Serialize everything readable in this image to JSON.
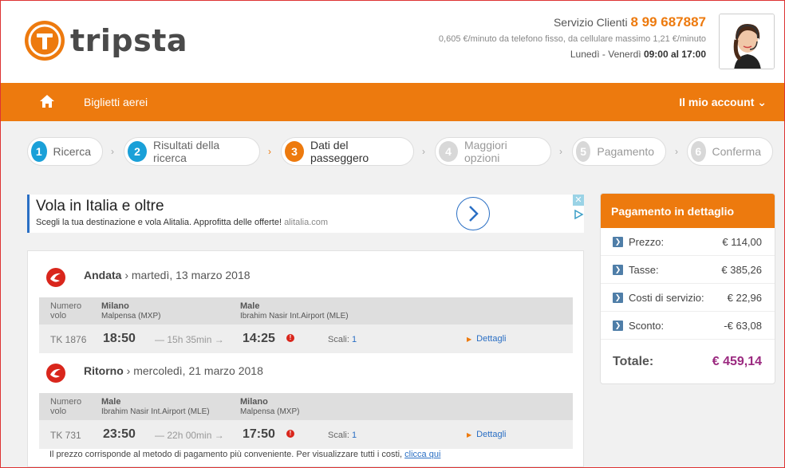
{
  "brand": {
    "name": "tripsta",
    "color": "#ed7a0e"
  },
  "contact": {
    "label": "Servizio Clienti",
    "phone": "8 99 687887",
    "rate": "0,605 €/minuto da telefono fisso, da cellulare massimo 1,21 €/minuto",
    "hours_prefix": "Lunedì - Venerdì",
    "hours": "09:00 al 17:00"
  },
  "nav": {
    "flights": "Biglietti aerei",
    "account": "Il mio account"
  },
  "steps": [
    {
      "n": "1",
      "label": "Ricerca",
      "state": "done"
    },
    {
      "n": "2",
      "label": "Risultati della ricerca",
      "state": "done"
    },
    {
      "n": "3",
      "label": "Dati del passeggero",
      "state": "active"
    },
    {
      "n": "4",
      "label": "Maggiori opzioni",
      "state": "future"
    },
    {
      "n": "5",
      "label": "Pagamento",
      "state": "future"
    },
    {
      "n": "6",
      "label": "Conferma",
      "state": "future"
    }
  ],
  "ad": {
    "title": "Vola in Italia e oltre",
    "text": "Scegli la tua destinazione e vola Alitalia. Approfitta delle offerte!",
    "domain": "alitalia.com"
  },
  "outbound": {
    "label": "Andata",
    "date": "› martedì, 13 marzo 2018",
    "hdr_flight": "Numero volo",
    "from_city": "Milano",
    "from_airport": "Malpensa (MXP)",
    "to_city": "Male",
    "to_airport": "Ibrahim Nasir Int.Airport (MLE)",
    "flight_no": "TK 1876",
    "depart": "18:50",
    "duration": "15h 35min",
    "arrive": "14:25",
    "stops_label": "Scali:",
    "stops": "1",
    "details": "Dettagli"
  },
  "return": {
    "label": "Ritorno",
    "date": "› mercoledì, 21 marzo 2018",
    "hdr_flight": "Numero volo",
    "from_city": "Male",
    "from_airport": "Ibrahim Nasir Int.Airport (MLE)",
    "to_city": "Milano",
    "to_airport": "Malpensa (MXP)",
    "flight_no": "TK 731",
    "depart": "23:50",
    "duration": "22h 00min",
    "arrive": "17:50",
    "stops_label": "Scali:",
    "stops": "1",
    "details": "Dettagli"
  },
  "note": {
    "text": "Il prezzo corrisponde al metodo di pagamento più conveniente. Per visualizzare tutti i costi,",
    "link": "clicca qui"
  },
  "payment": {
    "title": "Pagamento in dettaglio",
    "rows": [
      {
        "label": "Prezzo:",
        "value": "€ 114,00"
      },
      {
        "label": "Tasse:",
        "value": "€ 385,26"
      },
      {
        "label": "Costi di servizio:",
        "value": "€ 22,96"
      },
      {
        "label": "Sconto:",
        "value": "-€ 63,08"
      }
    ],
    "total_label": "Totale:",
    "total_value": "€ 459,14"
  }
}
